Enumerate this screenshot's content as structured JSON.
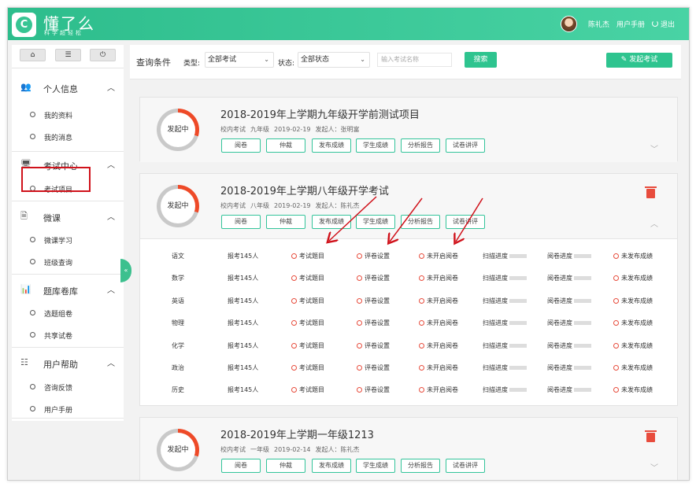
{
  "app": {
    "brand": "懂了么",
    "slogan": "科学超轻松",
    "logo_glyph": "C"
  },
  "topbar": {
    "user_name": "陈礼杰",
    "manual": "用户手册",
    "logout": "退出"
  },
  "sidebar": {
    "toolbar": {
      "home": "⌂",
      "list": "☰",
      "power": "⏻"
    },
    "groups": [
      {
        "icon": "users-icon",
        "glyph": "👥",
        "label": "个人信息",
        "items": [
          "我的资料",
          "我的消息"
        ]
      },
      {
        "icon": "monitor-icon",
        "glyph": "🖥",
        "label": "考试中心",
        "items": [
          "考试项目"
        ]
      },
      {
        "icon": "document-icon",
        "glyph": "🗎",
        "label": "微课",
        "items": [
          "微课学习",
          "班级查询"
        ]
      },
      {
        "icon": "chart-icon",
        "glyph": "📊",
        "label": "题库卷库",
        "items": [
          "选题组卷",
          "共享试卷"
        ]
      },
      {
        "icon": "help-list-icon",
        "glyph": "☷",
        "label": "用户帮助",
        "items": [
          "咨询反馈",
          "用户手册"
        ]
      }
    ],
    "collapse_glyph": "«"
  },
  "filter": {
    "title": "查询条件",
    "type_label": "类型:",
    "type_value": "全部考试",
    "status_label": "状态:",
    "status_value": "全部状态",
    "search_placeholder": "输入考试名称",
    "search_btn": "搜索",
    "launch_btn": "发起考试"
  },
  "cards": [
    {
      "status": "发起中",
      "title": "2018-2019年上学期九年级开学前测试项目",
      "meta": {
        "type": "校内考试",
        "grade": "九年级",
        "date": "2019-02-19",
        "launcher": "发起人：张明富"
      },
      "buttons": [
        "阅卷",
        "仲裁",
        "发布成绩",
        "学生成绩",
        "分析报告",
        "试卷讲评"
      ],
      "expanded": false
    },
    {
      "status": "发起中",
      "title": "2018-2019年上学期八年级开学考试",
      "meta": {
        "type": "校内考试",
        "grade": "八年级",
        "date": "2019-02-19",
        "launcher": "发起人：陈礼杰"
      },
      "buttons": [
        "阅卷",
        "仲裁",
        "发布成绩",
        "学生成绩",
        "分析报告",
        "试卷讲评"
      ],
      "expanded": true,
      "subjects": [
        {
          "name": "语文",
          "count": "报考145人",
          "c1": "考试题目",
          "c2": "评卷设置",
          "c3": "未开启阅卷",
          "c4": "扫描进度",
          "c5": "阅卷进度",
          "c6": "未发布成绩"
        },
        {
          "name": "数学",
          "count": "报考145人",
          "c1": "考试题目",
          "c2": "评卷设置",
          "c3": "未开启阅卷",
          "c4": "扫描进度",
          "c5": "阅卷进度",
          "c6": "未发布成绩"
        },
        {
          "name": "英语",
          "count": "报考145人",
          "c1": "考试题目",
          "c2": "评卷设置",
          "c3": "未开启阅卷",
          "c4": "扫描进度",
          "c5": "阅卷进度",
          "c6": "未发布成绩"
        },
        {
          "name": "物理",
          "count": "报考145人",
          "c1": "考试题目",
          "c2": "评卷设置",
          "c3": "未开启阅卷",
          "c4": "扫描进度",
          "c5": "阅卷进度",
          "c6": "未发布成绩"
        },
        {
          "name": "化学",
          "count": "报考145人",
          "c1": "考试题目",
          "c2": "评卷设置",
          "c3": "未开启阅卷",
          "c4": "扫描进度",
          "c5": "阅卷进度",
          "c6": "未发布成绩"
        },
        {
          "name": "政治",
          "count": "报考145人",
          "c1": "考试题目",
          "c2": "评卷设置",
          "c3": "未开启阅卷",
          "c4": "扫描进度",
          "c5": "阅卷进度",
          "c6": "未发布成绩"
        },
        {
          "name": "历史",
          "count": "报考145人",
          "c1": "考试题目",
          "c2": "评卷设置",
          "c3": "未开启阅卷",
          "c4": "扫描进度",
          "c5": "阅卷进度",
          "c6": "未发布成绩"
        }
      ]
    },
    {
      "status": "发起中",
      "title": "2018-2019年上学期一年级1213",
      "meta": {
        "type": "校内考试",
        "grade": "一年级",
        "date": "2019-02-14",
        "launcher": "发起人：陈礼杰"
      },
      "buttons": [
        "阅卷",
        "仲裁",
        "发布成绩",
        "学生成绩",
        "分析报告",
        "试卷讲评"
      ],
      "expanded": false
    }
  ],
  "colors": {
    "accent": "#2ec48f",
    "status_red": "#e74c3c",
    "highlight": "#d0121b"
  }
}
